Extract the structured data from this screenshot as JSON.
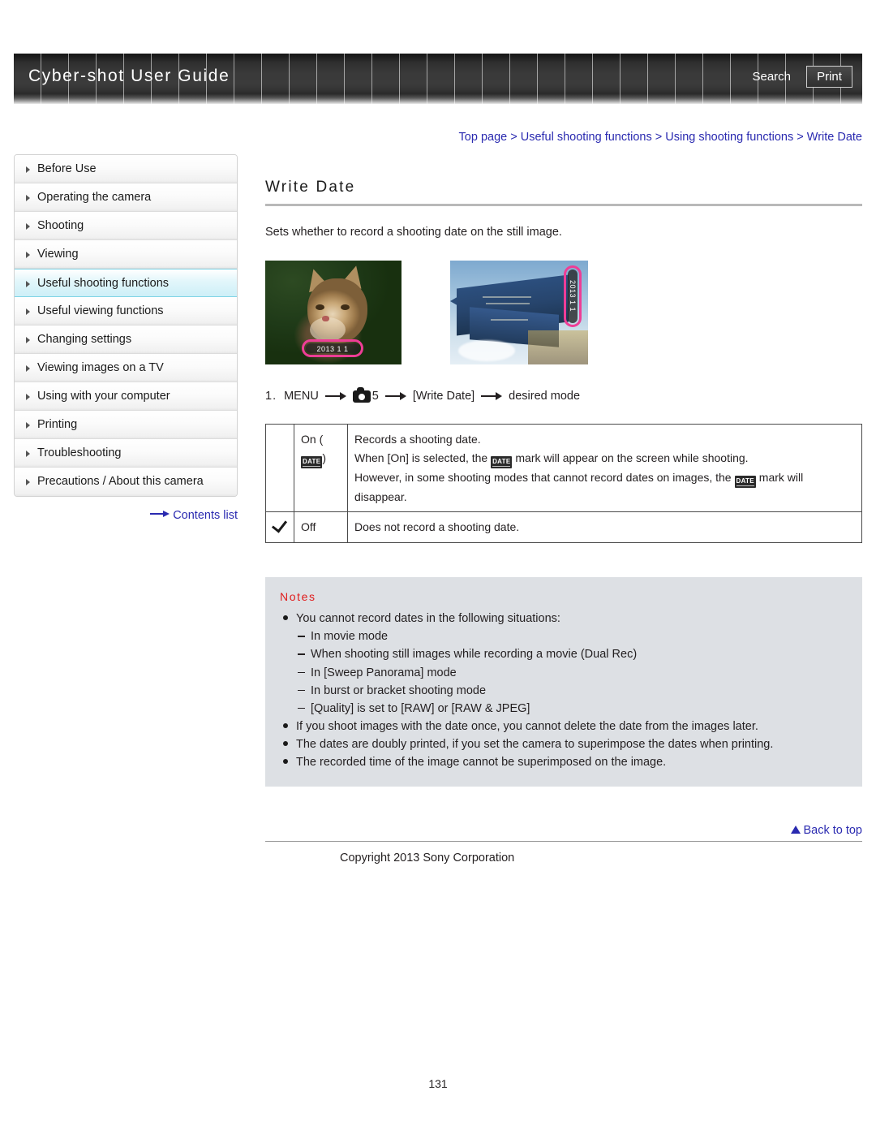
{
  "header": {
    "title": "Cyber-shot User Guide",
    "search_label": "Search",
    "print_label": "Print"
  },
  "breadcrumb": {
    "text": "Top page > Useful shooting functions > Using shooting functions > Write Date"
  },
  "sidebar": {
    "items": [
      {
        "label": "Before Use",
        "active": false
      },
      {
        "label": "Operating the camera",
        "active": false
      },
      {
        "label": "Shooting",
        "active": false
      },
      {
        "label": "Viewing",
        "active": false
      },
      {
        "label": "Useful shooting functions",
        "active": true
      },
      {
        "label": "Useful viewing functions",
        "active": false
      },
      {
        "label": "Changing settings",
        "active": false
      },
      {
        "label": "Viewing images on a TV",
        "active": false
      },
      {
        "label": "Using with your computer",
        "active": false
      },
      {
        "label": "Printing",
        "active": false
      },
      {
        "label": "Troubleshooting",
        "active": false
      },
      {
        "label": "Precautions / About this camera",
        "active": false
      }
    ],
    "contents_list_label": "Contents list"
  },
  "main": {
    "title": "Write Date",
    "intro": "Sets whether to record a shooting date on the still image.",
    "samples": [
      {
        "name": "cat-photo",
        "stamp_text": "2013  1  1"
      },
      {
        "name": "building-photo",
        "stamp_text": "2013  1  1"
      }
    ],
    "step": {
      "number": "1.",
      "menu": "MENU",
      "camera_tab": "5",
      "item": "[Write Date]",
      "result": "desired mode"
    },
    "options_table": {
      "rows": [
        {
          "checked": false,
          "name_prefix": "On (",
          "name_icon": "DATE",
          "name_suffix": ")",
          "lines": [
            "Records a shooting date.",
            "When [On] is selected, the  mark will appear on the screen while shooting.",
            "However, in some shooting modes that cannot record dates on images, the  mark will disappear."
          ],
          "line1": "Records a shooting date.",
          "line2a": "When [On] is selected, the",
          "line2b": "mark will appear on the screen while shooting.",
          "line3a": "However, in some shooting modes that cannot record dates on images, the",
          "line3b": "mark will disappear."
        },
        {
          "checked": true,
          "name": "Off",
          "description": "Does not record a shooting date."
        }
      ]
    },
    "notes": {
      "title": "Notes",
      "items": [
        {
          "text": "You cannot record dates in the following situations:",
          "subitems": [
            "In movie mode",
            "When shooting still images while recording a movie (Dual Rec)",
            "In [Sweep Panorama] mode",
            "In burst or bracket shooting mode",
            "[Quality] is set to [RAW] or [RAW & JPEG]"
          ]
        },
        {
          "text": "If you shoot images with the date once, you cannot delete the date from the images later.",
          "subitems": []
        },
        {
          "text": "The dates are doubly printed, if you set the camera to superimpose the dates when printing.",
          "subitems": []
        },
        {
          "text": "The recorded time of the image cannot be superimposed on the image.",
          "subitems": []
        }
      ]
    }
  },
  "footer": {
    "back_to_top": "Back to top",
    "copyright": "Copyright 2013 Sony Corporation",
    "page_number": "131"
  },
  "colors": {
    "link": "#2a2ab0",
    "notes_title": "#e01b1b",
    "notes_bg": "#dde0e4",
    "active_nav": "#cdeff7",
    "stamp_highlight": "#ee3d96"
  }
}
